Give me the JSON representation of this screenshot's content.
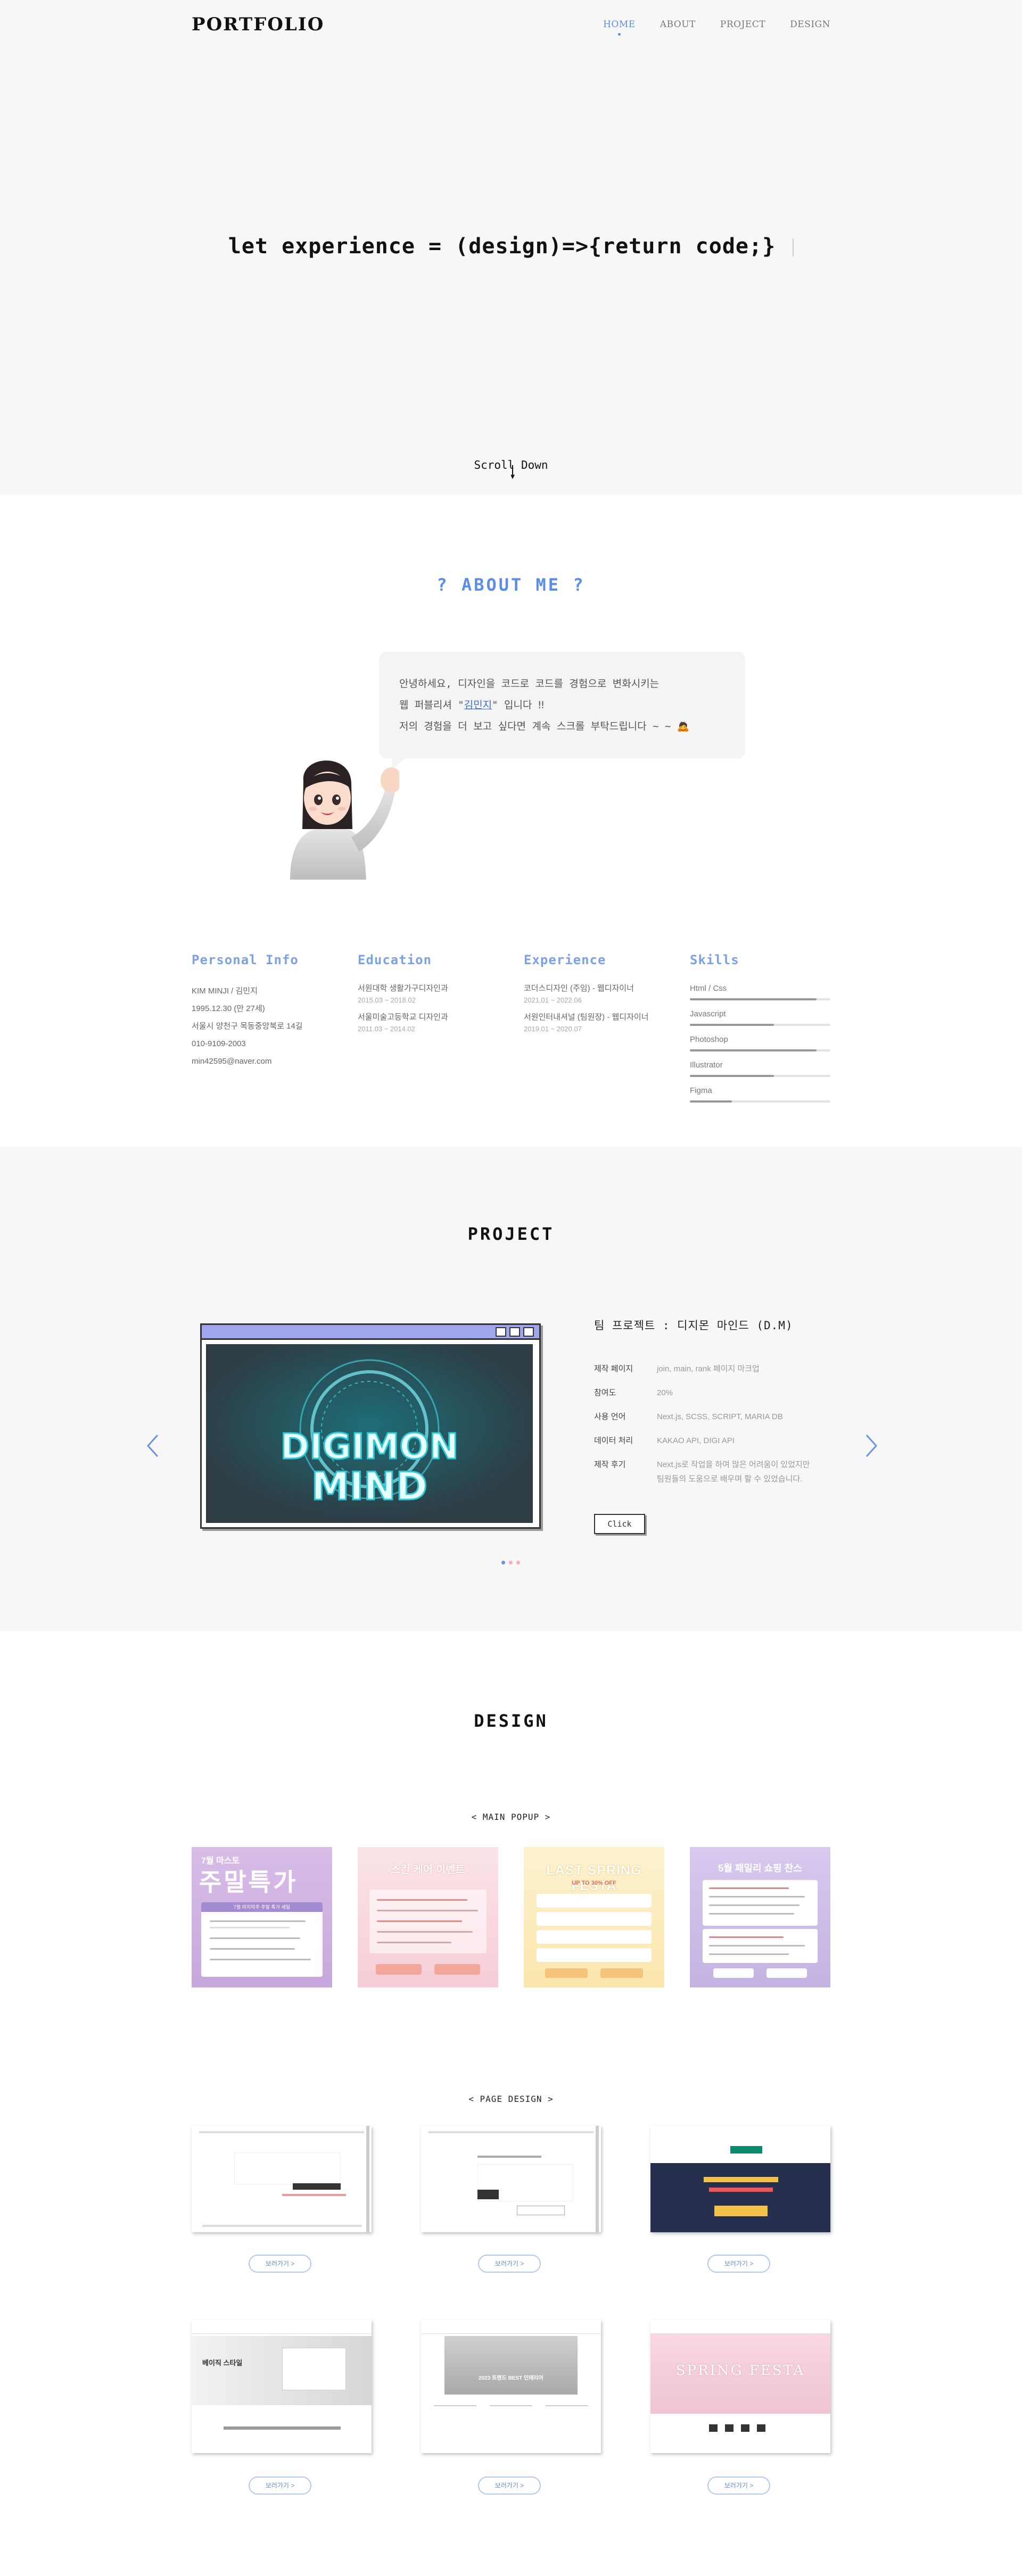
{
  "header": {
    "logo": "PORTFOLIO",
    "nav": [
      "HOME",
      "ABOUT",
      "PROJECT",
      "DESIGN"
    ],
    "active_nav": "HOME"
  },
  "hero": {
    "code": "let experience = (design)=>{return code;}",
    "scroll": "Scroll Down"
  },
  "about": {
    "title": "? ABOUT ME ?",
    "bubble": {
      "line1": "안녕하세요, 디자인을 코드로 코드를 경험으로 변화시키는",
      "line2_pre": "웹 퍼블리셔 \"",
      "line2_name": "김민지",
      "line2_post": "\" 입니다 ‼",
      "line3": "저의 경험을 더 보고 싶다면 계속 스크롤 부탁드립니다 ~ ~"
    },
    "personal": {
      "title": "Personal Info",
      "items": [
        "KIM MINJI / 김민지",
        "1995.12.30 (만 27세)",
        "서울시 양천구 목동중앙북로 14길",
        "010-9109-2003",
        "min42595@naver.com"
      ]
    },
    "education": {
      "title": "Education",
      "items": [
        {
          "name": "서원대학 생활가구디자인과",
          "date": "2015.03 ~ 2018.02"
        },
        {
          "name": "서울미술고등학교 디자인과",
          "date": "2011.03 ~ 2014.02"
        }
      ]
    },
    "experience": {
      "title": "Experience",
      "items": [
        {
          "name": "코더스디자인 (주임) - 웹디자이너",
          "date": "2021.01 ~ 2022.06"
        },
        {
          "name": "서원인터내셔널 (팀원장) - 웹디자이너",
          "date": "2019.01 ~ 2020.07"
        }
      ]
    },
    "skills": {
      "title": "Skills",
      "items": [
        {
          "name": "Html / Css",
          "level": 0.9
        },
        {
          "name": "Javascript",
          "level": 0.6
        },
        {
          "name": "Photoshop",
          "level": 0.9
        },
        {
          "name": "Illustrator",
          "level": 0.6
        },
        {
          "name": "Figma",
          "level": 0.3
        }
      ]
    }
  },
  "project": {
    "title": "PROJECT",
    "item_title": "팀 프로젝트 : 디지몬 마인드 (D.M)",
    "image_text": [
      "DIGIMON",
      "MIND"
    ],
    "rows": [
      {
        "k": "제작 페이지",
        "v": "join, main, rank 페이지 마크업"
      },
      {
        "k": "참여도",
        "v": "20%"
      },
      {
        "k": "사용 언어",
        "v": "Next.js, SCSS, SCRIPT, MARIA DB"
      },
      {
        "k": "데이터 처리",
        "v": "KAKAO API, DIGI API"
      },
      {
        "k": "제작 후기",
        "v": "Next.js로 작업을 하여 많은 어려움이 있었지만"
      }
    ],
    "note2": "팀원들의 도움으로 배우며 할 수 있었습니다.",
    "button": "Click",
    "slides": 3,
    "active_slide": 0
  },
  "design": {
    "title": "DESIGN",
    "main_popup": "< MAIN POPUP >",
    "page_design": "< PAGE DESIGN >",
    "popups": [
      {
        "headline": "주말특가",
        "top": "7월 마스토",
        "sub": "7월 마지막주 주말 특가 세일",
        "color1": "#d7b8e6",
        "color2": "#c9a6de"
      },
      {
        "headline": "스킨 케어 이벤트",
        "top": "",
        "sub": "",
        "color1": "#fbe1e4",
        "color2": "#f7cfd6"
      },
      {
        "headline": "LAST SPRING FESTA",
        "top": "",
        "sub": "UP TO 30% OFF",
        "color1": "#fdf0c8",
        "color2": "#fbe6a8"
      },
      {
        "headline": "5월 패밀리 쇼핑 찬스",
        "top": "",
        "sub": "",
        "color1": "#d6c7ec",
        "color2": "#c6b8e6"
      }
    ],
    "more_label": "보러가기 >",
    "page_labels": [
      "2023 트렌드 BEST 인테리어",
      "베이직 스타일",
      "SPRING FESTA"
    ]
  }
}
